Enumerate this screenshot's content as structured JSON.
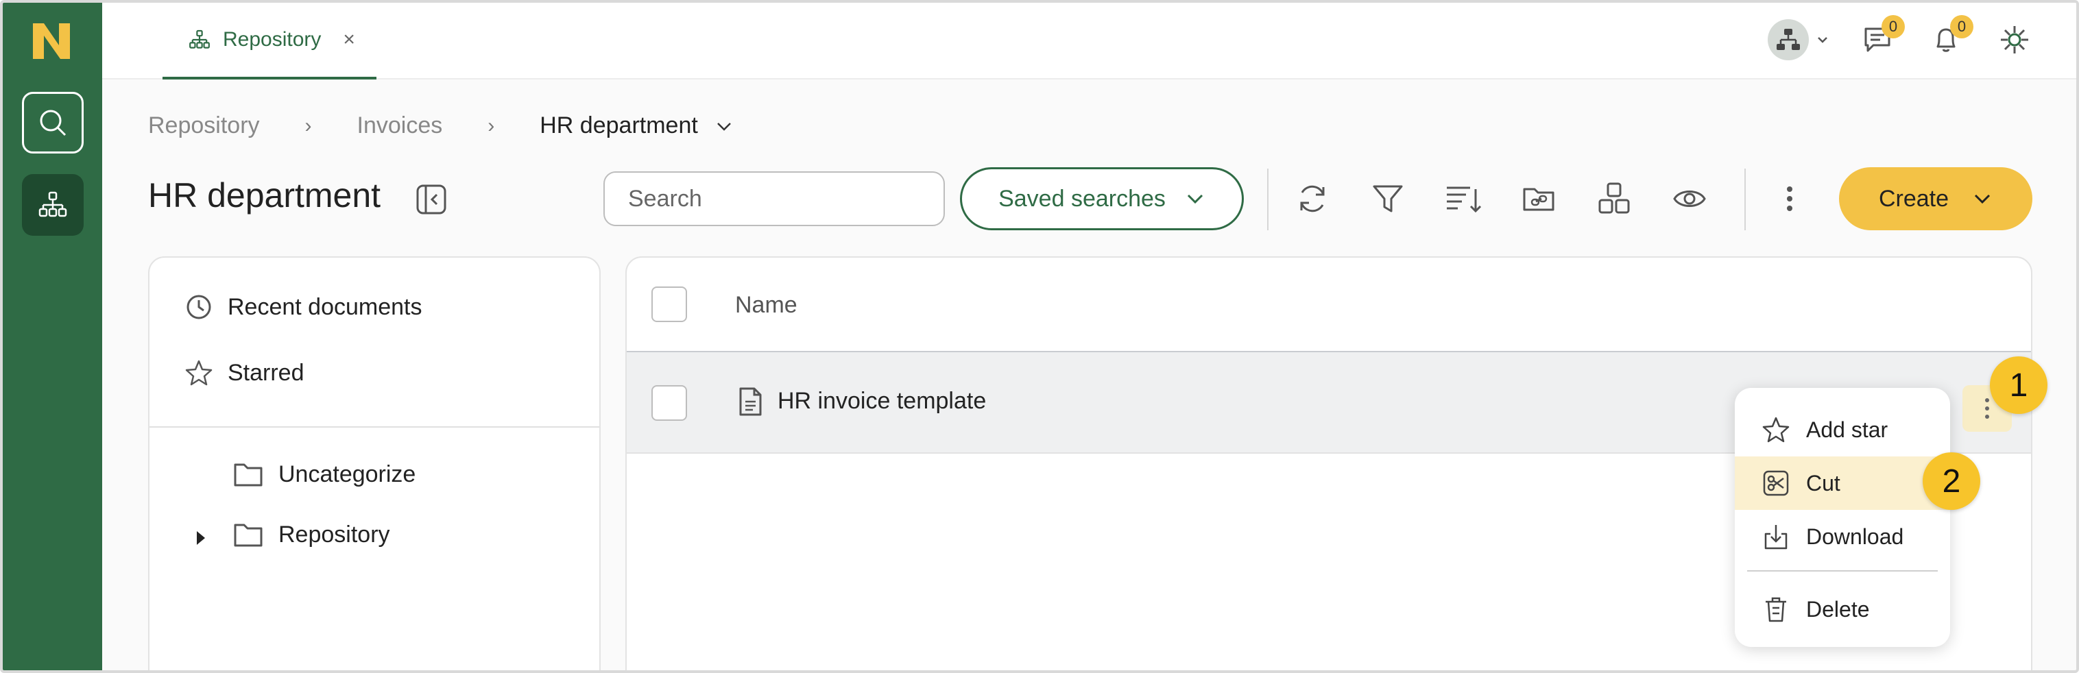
{
  "brand": {
    "logo_letter": "N",
    "logo_color": "#f3c246",
    "rail_color": "#2f6b45"
  },
  "topbar": {
    "tab_label": "Repository",
    "tab_close": "×",
    "chat_badge": "0",
    "notif_badge": "0"
  },
  "breadcrumb": {
    "items": [
      "Repository",
      "Invoices",
      "HR department"
    ],
    "separator": "›"
  },
  "header": {
    "title": "HR department",
    "search_placeholder": "Search",
    "saved_searches_label": "Saved searches",
    "create_label": "Create"
  },
  "sidebar": {
    "items": [
      {
        "label": "Recent documents",
        "icon": "clock-icon"
      },
      {
        "label": "Starred",
        "icon": "star-icon"
      }
    ],
    "folders": [
      {
        "label": "Uncategorize",
        "icon": "folder-icon",
        "expandable": false
      },
      {
        "label": "Repository",
        "icon": "folder-icon",
        "expandable": true
      }
    ]
  },
  "table": {
    "columns": [
      "Name"
    ],
    "rows": [
      {
        "name": "HR invoice template",
        "icon": "document-icon"
      }
    ]
  },
  "context_menu": {
    "items": [
      {
        "label": "Add star",
        "icon": "star-icon"
      },
      {
        "label": "Cut",
        "icon": "scissors-icon",
        "highlighted": true
      },
      {
        "label": "Download",
        "icon": "download-icon"
      },
      {
        "label": "Delete",
        "icon": "trash-icon"
      }
    ]
  },
  "callouts": [
    "1",
    "2"
  ],
  "colors": {
    "accent": "#2f6b45",
    "highlight": "#f3c246",
    "callout": "#f7c42b"
  }
}
